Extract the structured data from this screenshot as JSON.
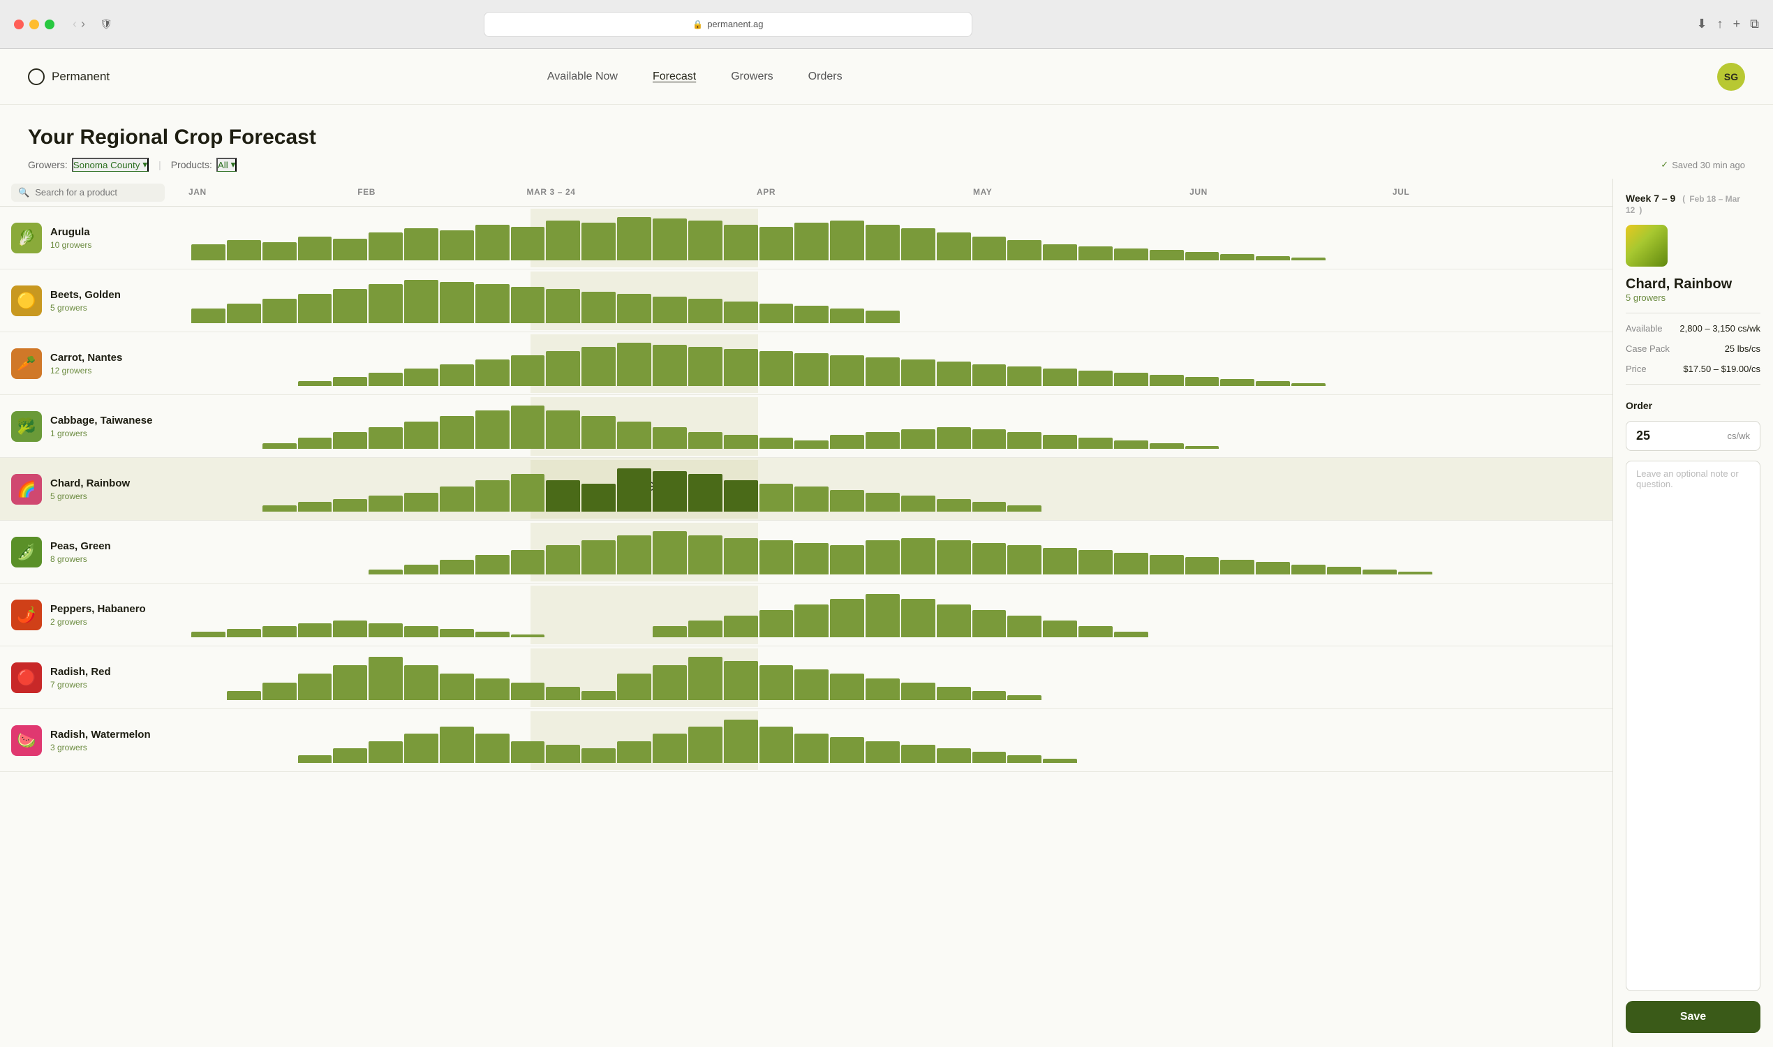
{
  "browser": {
    "url": "permanent.ag",
    "shield_icon": "🛡",
    "reload_icon": "↺"
  },
  "nav": {
    "logo": "Permanent",
    "links": [
      {
        "label": "Available Now",
        "active": false
      },
      {
        "label": "Forecast",
        "active": true
      },
      {
        "label": "Growers",
        "active": false
      },
      {
        "label": "Orders",
        "active": false
      }
    ],
    "user_initials": "SG"
  },
  "page": {
    "title": "Your Regional Crop Forecast",
    "growers_label": "Growers:",
    "growers_value": "Sonoma County",
    "products_label": "Products:",
    "products_value": "All",
    "saved_notice": "Saved 30 min ago",
    "search_placeholder": "Search for a product"
  },
  "months": [
    {
      "label": "JAN",
      "pct": 0
    },
    {
      "label": "FEB",
      "pct": 12.5
    },
    {
      "label": "MAR 3 – 24",
      "pct": 25
    },
    {
      "label": "APR",
      "pct": 42
    },
    {
      "label": "MAY",
      "pct": 58
    },
    {
      "label": "JUN",
      "pct": 74
    },
    {
      "label": "JUL",
      "pct": 89
    }
  ],
  "panel": {
    "week_label": "Week 7 – 9",
    "date_range": "Feb 18 – Mar 12",
    "crop_name": "Chard, Rainbow",
    "growers": "5 growers",
    "available_label": "Available",
    "available_value": "2,800 – 3,150 cs/wk",
    "case_pack_label": "Case Pack",
    "case_pack_value": "25 lbs/cs",
    "price_label": "Price",
    "price_value": "$17.50 – $19.00/cs",
    "order_label": "Order",
    "order_qty": "25",
    "order_unit": "cs/wk",
    "note_placeholder": "Leave an optional note or question.",
    "save_label": "Save"
  },
  "crops": [
    {
      "name": "Arugula",
      "growers": "10 growers",
      "emoji": "🥬",
      "color": "#7a8a2a",
      "selected": false,
      "bars": [
        8,
        10,
        9,
        12,
        11,
        14,
        16,
        15,
        18,
        17,
        20,
        19,
        22,
        21,
        20,
        18,
        17,
        19,
        20,
        18,
        16,
        14,
        12,
        10,
        8,
        7,
        6,
        5,
        4,
        3,
        2,
        1,
        0,
        0,
        0,
        0,
        0,
        0,
        0,
        0
      ]
    },
    {
      "name": "Beets, Golden",
      "growers": "5 growers",
      "emoji": "🟡",
      "color": "#d4a820",
      "selected": false,
      "bars": [
        6,
        8,
        10,
        12,
        14,
        16,
        18,
        17,
        16,
        15,
        14,
        13,
        12,
        11,
        10,
        9,
        8,
        7,
        6,
        5,
        0,
        0,
        0,
        0,
        0,
        0,
        0,
        0,
        0,
        0,
        0,
        0,
        0,
        0,
        0,
        0,
        0,
        0,
        0,
        0
      ]
    },
    {
      "name": "Carrot, Nantes",
      "growers": "12 growers",
      "emoji": "🥕",
      "color": "#d07820",
      "selected": false,
      "bars": [
        0,
        0,
        0,
        2,
        4,
        6,
        8,
        10,
        12,
        14,
        16,
        18,
        20,
        19,
        18,
        17,
        16,
        15,
        14,
        13,
        12,
        11,
        10,
        9,
        8,
        7,
        6,
        5,
        4,
        3,
        2,
        1,
        0,
        0,
        0,
        0,
        0,
        0,
        0,
        0
      ]
    },
    {
      "name": "Cabbage, Taiwanese",
      "growers": "1 growers",
      "emoji": "🥦",
      "color": "#5a7a28",
      "selected": false,
      "bars": [
        0,
        0,
        2,
        4,
        6,
        8,
        10,
        12,
        14,
        16,
        14,
        12,
        10,
        8,
        6,
        5,
        4,
        3,
        5,
        6,
        7,
        8,
        7,
        6,
        5,
        4,
        3,
        2,
        1,
        0,
        0,
        0,
        0,
        0,
        0,
        0,
        0,
        0,
        0,
        0
      ]
    },
    {
      "name": "Chard, Rainbow",
      "growers": "5 growers",
      "emoji": "🌈",
      "color": "#d43060",
      "selected": true,
      "bars": [
        0,
        0,
        2,
        3,
        4,
        5,
        6,
        8,
        10,
        12,
        10,
        9,
        14,
        13,
        12,
        10,
        9,
        8,
        7,
        6,
        5,
        4,
        3,
        2,
        0,
        0,
        0,
        0,
        0,
        0,
        0,
        0,
        0,
        0,
        0,
        0,
        0,
        0,
        0,
        0
      ]
    },
    {
      "name": "Peas, Green",
      "growers": "8 growers",
      "emoji": "🫛",
      "color": "#5a9020",
      "selected": false,
      "bars": [
        0,
        0,
        0,
        0,
        0,
        2,
        4,
        6,
        8,
        10,
        12,
        14,
        16,
        18,
        16,
        15,
        14,
        13,
        12,
        14,
        15,
        14,
        13,
        12,
        11,
        10,
        9,
        8,
        7,
        6,
        5,
        4,
        3,
        2,
        1,
        0,
        0,
        0,
        0,
        0
      ]
    },
    {
      "name": "Peppers, Habanero",
      "growers": "2 growers",
      "emoji": "🌶️",
      "color": "#d84010",
      "selected": false,
      "bars": [
        2,
        3,
        4,
        5,
        6,
        5,
        4,
        3,
        2,
        1,
        0,
        0,
        0,
        4,
        6,
        8,
        10,
        12,
        14,
        16,
        14,
        12,
        10,
        8,
        6,
        4,
        2,
        0,
        0,
        0,
        0,
        0,
        0,
        0,
        0,
        0,
        0,
        0,
        0,
        0
      ]
    },
    {
      "name": "Radish, Red",
      "growers": "7 growers",
      "emoji": "🔴",
      "color": "#d43030",
      "selected": false,
      "bars": [
        0,
        2,
        4,
        6,
        8,
        10,
        8,
        6,
        5,
        4,
        3,
        2,
        6,
        8,
        10,
        9,
        8,
        7,
        6,
        5,
        4,
        3,
        2,
        1,
        0,
        0,
        0,
        0,
        0,
        0,
        0,
        0,
        0,
        0,
        0,
        0,
        0,
        0,
        0,
        0
      ]
    },
    {
      "name": "Radish, Watermelon",
      "growers": "3 growers",
      "emoji": "🍉",
      "color": "#e04080",
      "selected": false,
      "bars": [
        0,
        0,
        0,
        2,
        4,
        6,
        8,
        10,
        8,
        6,
        5,
        4,
        6,
        8,
        10,
        12,
        10,
        8,
        7,
        6,
        5,
        4,
        3,
        2,
        1,
        0,
        0,
        0,
        0,
        0,
        0,
        0,
        0,
        0,
        0,
        0,
        0,
        0,
        0,
        0
      ]
    }
  ]
}
